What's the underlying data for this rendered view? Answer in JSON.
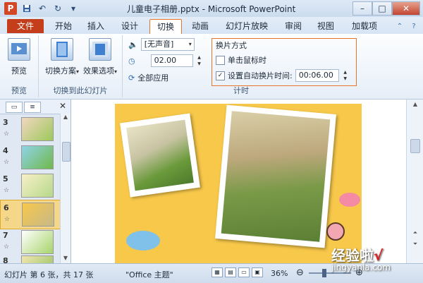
{
  "titlebar": {
    "title": "儿童电子相册.pptx - Microsoft PowerPoint",
    "app_icon_letter": "P"
  },
  "tabs": [
    {
      "label": "文件"
    },
    {
      "label": "开始"
    },
    {
      "label": "插入"
    },
    {
      "label": "设计"
    },
    {
      "label": "切换"
    },
    {
      "label": "动画"
    },
    {
      "label": "幻灯片放映"
    },
    {
      "label": "审阅"
    },
    {
      "label": "视图"
    },
    {
      "label": "加载项"
    }
  ],
  "ribbon": {
    "preview": {
      "label": "预览",
      "group": "预览"
    },
    "transition_scheme": {
      "label": "切换方案"
    },
    "effect_options": {
      "label": "效果选项"
    },
    "group_transition": "切换到此幻灯片",
    "sound": {
      "value": "[无声音]"
    },
    "duration": {
      "value": "02.00"
    },
    "apply_all": {
      "label": "全部应用"
    },
    "advance": {
      "title": "换片方式",
      "on_click": {
        "label": "单击鼠标时",
        "checked": false
      },
      "after": {
        "label": "设置自动换片时间:",
        "checked": true,
        "value": "00:06.00"
      }
    },
    "group_timing": "计时"
  },
  "slides_panel": {
    "items": [
      {
        "num": "3",
        "selected": false
      },
      {
        "num": "4",
        "selected": false
      },
      {
        "num": "5",
        "selected": false
      },
      {
        "num": "6",
        "selected": true
      },
      {
        "num": "7",
        "selected": false
      },
      {
        "num": "8",
        "selected": false
      }
    ],
    "star": "☆"
  },
  "status": {
    "slide_info": "幻灯片 第 6 张，共 17 张",
    "theme": "\"Office 主题\"",
    "zoom": "36%",
    "zoom_fraction": 0.36
  },
  "watermark": {
    "text": "经验啦",
    "check": "√",
    "url": "jingyanla.com"
  },
  "colors": {
    "accent": "#e8742c",
    "file_tab": "#c43e1c",
    "slide_bg": "#f7c84a"
  }
}
